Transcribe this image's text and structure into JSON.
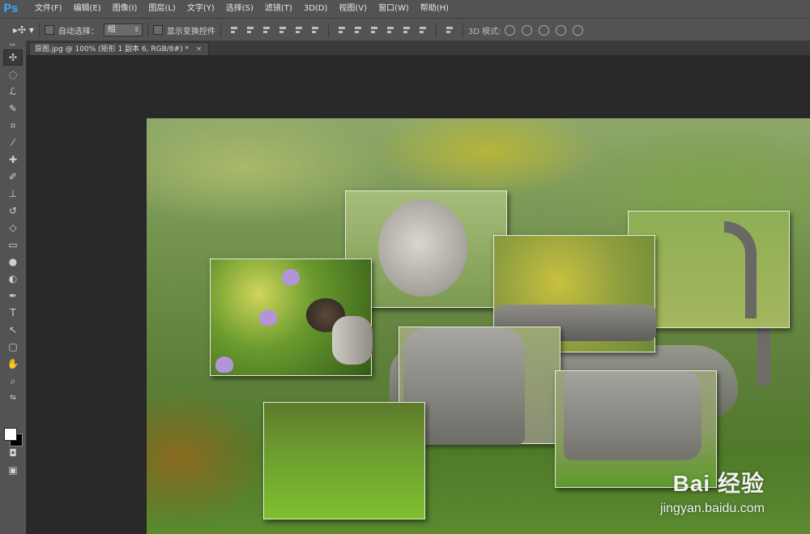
{
  "app": {
    "logo": "Ps"
  },
  "menu": [
    "文件(F)",
    "编辑(E)",
    "图像(I)",
    "图层(L)",
    "文字(Y)",
    "选择(S)",
    "滤镜(T)",
    "3D(D)",
    "视图(V)",
    "窗口(W)",
    "帮助(H)"
  ],
  "options": {
    "auto_select_label": "自动选择：",
    "auto_select_value": "组",
    "show_transform_label": "显示变换控件",
    "mode3d_label": "3D 模式:"
  },
  "document_tab": {
    "title": "原图.jpg @ 100% (矩形 1 副本 6, RGB/8#) *",
    "close": "×"
  },
  "tools": [
    "move-tool",
    "marquee-tool",
    "lasso-tool",
    "quick-select-tool",
    "crop-tool",
    "eyedropper-tool",
    "healing-brush-tool",
    "brush-tool",
    "stamp-tool",
    "history-brush-tool",
    "eraser-tool",
    "gradient-tool",
    "blur-tool",
    "dodge-tool",
    "pen-tool",
    "type-tool",
    "path-select-tool",
    "rectangle-tool",
    "hand-tool",
    "zoom-tool"
  ],
  "colors": {
    "foreground": "#ffffff",
    "background": "#000000"
  },
  "watermark": {
    "main": "Bai  经验",
    "url": "jingyan.baidu.com"
  }
}
